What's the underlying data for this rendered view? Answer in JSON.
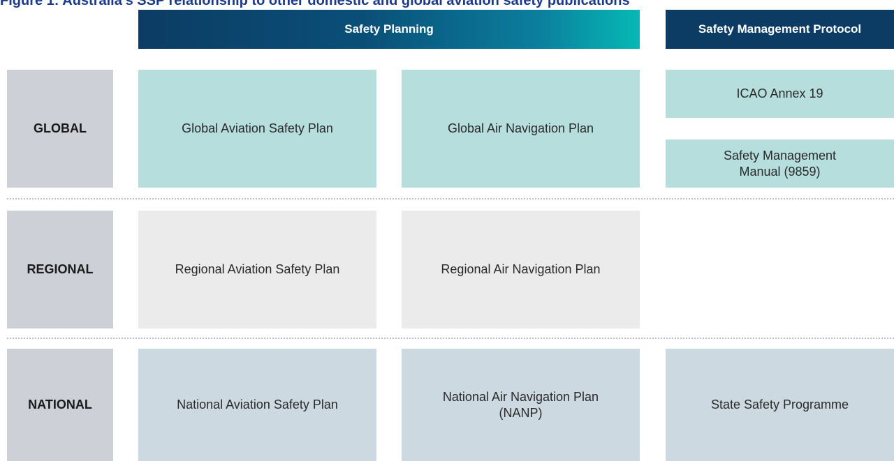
{
  "title": "Figure 1: Australia's SSP relationship to other domestic and global aviation safety publications",
  "headers": {
    "planning": "Safety Planning",
    "protocol": "Safety Management Protocol"
  },
  "rows": {
    "global": {
      "label": "GLOBAL",
      "aviation_safety": "Global Aviation Safety Plan",
      "air_navigation": "Global Air Navigation Plan",
      "annex": "ICAO Annex 19",
      "manual": "Safety Management\nManual (9859)"
    },
    "regional": {
      "label": "REGIONAL",
      "aviation_safety": "Regional Aviation Safety Plan",
      "air_navigation": "Regional Air Navigation Plan"
    },
    "national": {
      "label": "NATIONAL",
      "aviation_safety": "National Aviation Safety Plan",
      "air_navigation": "National Air Navigation Plan\n(NANP)",
      "programme": "State Safety Programme"
    }
  },
  "colors": {
    "title": "#1b3b8a",
    "header_dark": "#0c3c63",
    "header_gradient_end": "#06b9b4",
    "global_box": "#b5dedd",
    "regional_box": "#ebebeb",
    "national_box": "#cdd9e0",
    "row_label": "#cdd0d6"
  }
}
